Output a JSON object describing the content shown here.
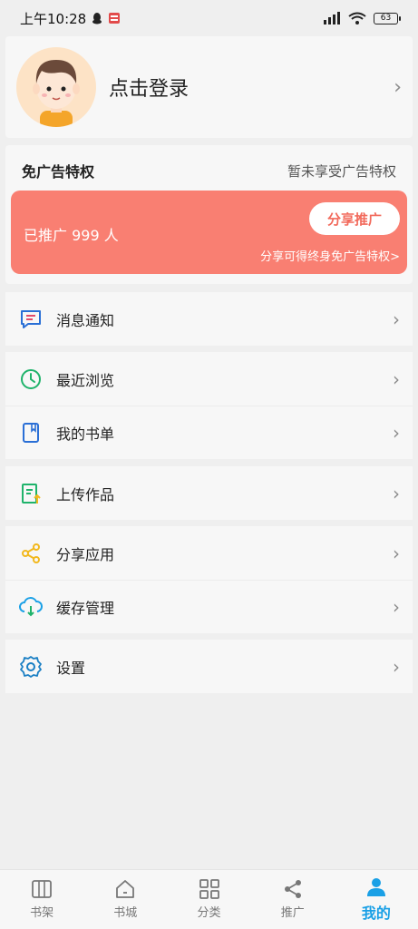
{
  "status_bar": {
    "time": "上午10:28",
    "battery": "63"
  },
  "profile": {
    "login_text": "点击登录"
  },
  "ad": {
    "title": "免广告特权",
    "status": "暂未享受广告特权",
    "promoted": "已推广 999 人",
    "share_button": "分享推广",
    "hint": "分享可得终身免广告特权>"
  },
  "menu": [
    {
      "label": "消息通知",
      "icon": "message-icon",
      "color": "#2a6fd6"
    },
    {
      "label": "最近浏览",
      "icon": "clock-icon",
      "color": "#1fb36b"
    },
    {
      "label": "我的书单",
      "icon": "booklist-icon",
      "color": "#2a6fd6"
    },
    {
      "label": "上传作品",
      "icon": "upload-icon",
      "color": "#1fb36b"
    },
    {
      "label": "分享应用",
      "icon": "share-icon",
      "color": "#f2b81d"
    },
    {
      "label": "缓存管理",
      "icon": "cloud-download-icon",
      "color": "#1aa0e6"
    },
    {
      "label": "设置",
      "icon": "gear-icon",
      "color": "#1a7fc4"
    }
  ],
  "tabs": [
    {
      "label": "书架",
      "icon": "bookshelf-icon"
    },
    {
      "label": "书城",
      "icon": "home-icon"
    },
    {
      "label": "分类",
      "icon": "grid-icon"
    },
    {
      "label": "推广",
      "icon": "share-icon"
    },
    {
      "label": "我的",
      "icon": "person-icon",
      "active": true
    }
  ],
  "colors": {
    "accent": "#1aa0e6",
    "banner": "#f97f72"
  }
}
